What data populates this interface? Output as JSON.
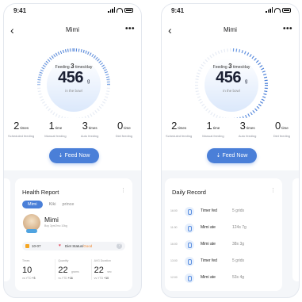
{
  "status_bar": {
    "time": "9:41"
  },
  "header": {
    "title": "Mimi",
    "back": "‹",
    "more": "•••"
  },
  "feeding": {
    "prefix": "Feeding",
    "count": "3",
    "suffix": "times/day",
    "amount": "456",
    "unit": "g",
    "note": "in the bowl"
  },
  "stats": [
    {
      "value": "2",
      "unit": "times",
      "label": "Scheduled feeding"
    },
    {
      "value": "1",
      "unit": "time",
      "label": "Manual feeding"
    },
    {
      "value": "3",
      "unit": "times",
      "label": "Auto feeding"
    },
    {
      "value": "0",
      "unit": "time",
      "label": "Diet feeding"
    }
  ],
  "feed_button": "Feed Now",
  "health_report": {
    "title": "Health Report",
    "menu": "⋮",
    "pets": [
      "Mimi",
      "Kiki",
      "prince"
    ],
    "pet_name": "Mimi",
    "pet_info": "Boy   3yrs7mo   10kg",
    "diet_date": "10-07",
    "diet_label": "Diet Status/",
    "diet_value": "Good",
    "help": "?",
    "metrics": [
      {
        "label": "Times",
        "value": "10",
        "unit": "",
        "compare": "vs.YTD",
        "change": "+3"
      },
      {
        "label": "Quantity",
        "value": "22",
        "unit": "grams",
        "compare": "vs.YTD",
        "change": "+16"
      },
      {
        "label": "AVG Duration",
        "value": "22",
        "unit": "sec",
        "compare": "vs.YTD",
        "change": "+10"
      }
    ]
  },
  "daily_record": {
    "title": "Daily Record",
    "menu": "⋮",
    "rows": [
      {
        "time": "16:00",
        "action": "Timer fed",
        "detail": "5 grids"
      },
      {
        "time": "11:00",
        "action": "Mimi ate",
        "detail": "124s   7g"
      },
      {
        "time": "16:00",
        "action": "Mimi ate",
        "detail": "38s   3g"
      },
      {
        "time": "13:00",
        "action": "Timer fed",
        "detail": "5 grids"
      },
      {
        "time": "12:00",
        "action": "Mimi ate",
        "detail": "53s   4g"
      }
    ]
  },
  "colors": {
    "accent": "#4a7fd8",
    "warning": "#f0852d",
    "heart": "#e64a5d"
  }
}
